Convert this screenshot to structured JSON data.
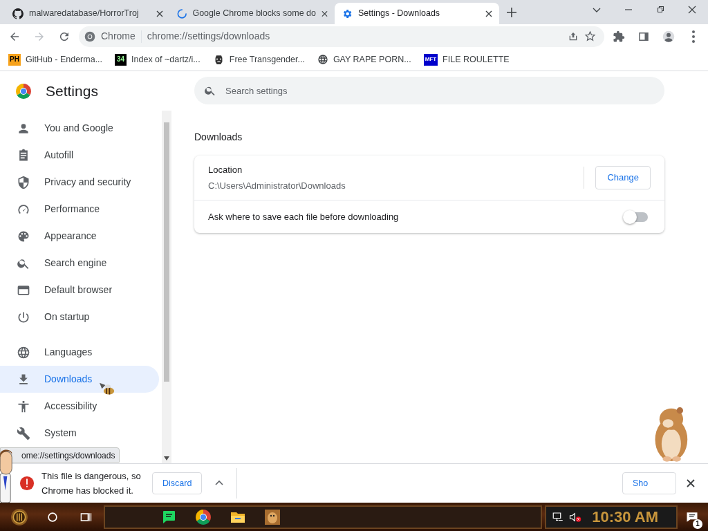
{
  "tabs": [
    {
      "title": "malwaredatabase/HorrorTroj",
      "selected": false
    },
    {
      "title": "Google Chrome blocks some do",
      "selected": false
    },
    {
      "title": "Settings - Downloads",
      "selected": true
    }
  ],
  "omnibox": {
    "chip": "Chrome",
    "url": "chrome://settings/downloads"
  },
  "bookmarks": [
    {
      "icon_text": "PH",
      "label": "GitHub - Enderma..."
    },
    {
      "icon_text": "34",
      "label": "Index of ~dartz/i..."
    },
    {
      "label": "Free Transgender..."
    },
    {
      "label": "GAY RAPE PORN..."
    },
    {
      "icon_text": "MFT",
      "label": "FILE ROULETTE"
    }
  ],
  "settings": {
    "title": "Settings",
    "search_placeholder": "Search settings",
    "nav_groups": [
      [
        {
          "label": "You and Google",
          "selected": false
        },
        {
          "label": "Autofill",
          "selected": false
        },
        {
          "label": "Privacy and security",
          "selected": false
        },
        {
          "label": "Performance",
          "selected": false
        },
        {
          "label": "Appearance",
          "selected": false
        },
        {
          "label": "Search engine",
          "selected": false
        },
        {
          "label": "Default browser",
          "selected": false
        },
        {
          "label": "On startup",
          "selected": false
        }
      ],
      [
        {
          "label": "Languages",
          "selected": false
        },
        {
          "label": "Downloads",
          "selected": true
        },
        {
          "label": "Accessibility",
          "selected": false
        },
        {
          "label": "System",
          "selected": false
        }
      ]
    ]
  },
  "downloads": {
    "heading": "Downloads",
    "location_label": "Location",
    "location_path": "C:\\Users\\Administrator\\Downloads",
    "change_button": "Change",
    "ask_label": "Ask where to save each file before downloading",
    "ask_toggle": {
      "on": false
    }
  },
  "status_tooltip": "ome://settings/downloads",
  "shelf": {
    "message": "This file is dangerous, so Chrome has blocked it.",
    "discard": "Discard",
    "show": "Sho"
  },
  "taskbar": {
    "clock": "10:30 AM",
    "notification_count": "1"
  }
}
